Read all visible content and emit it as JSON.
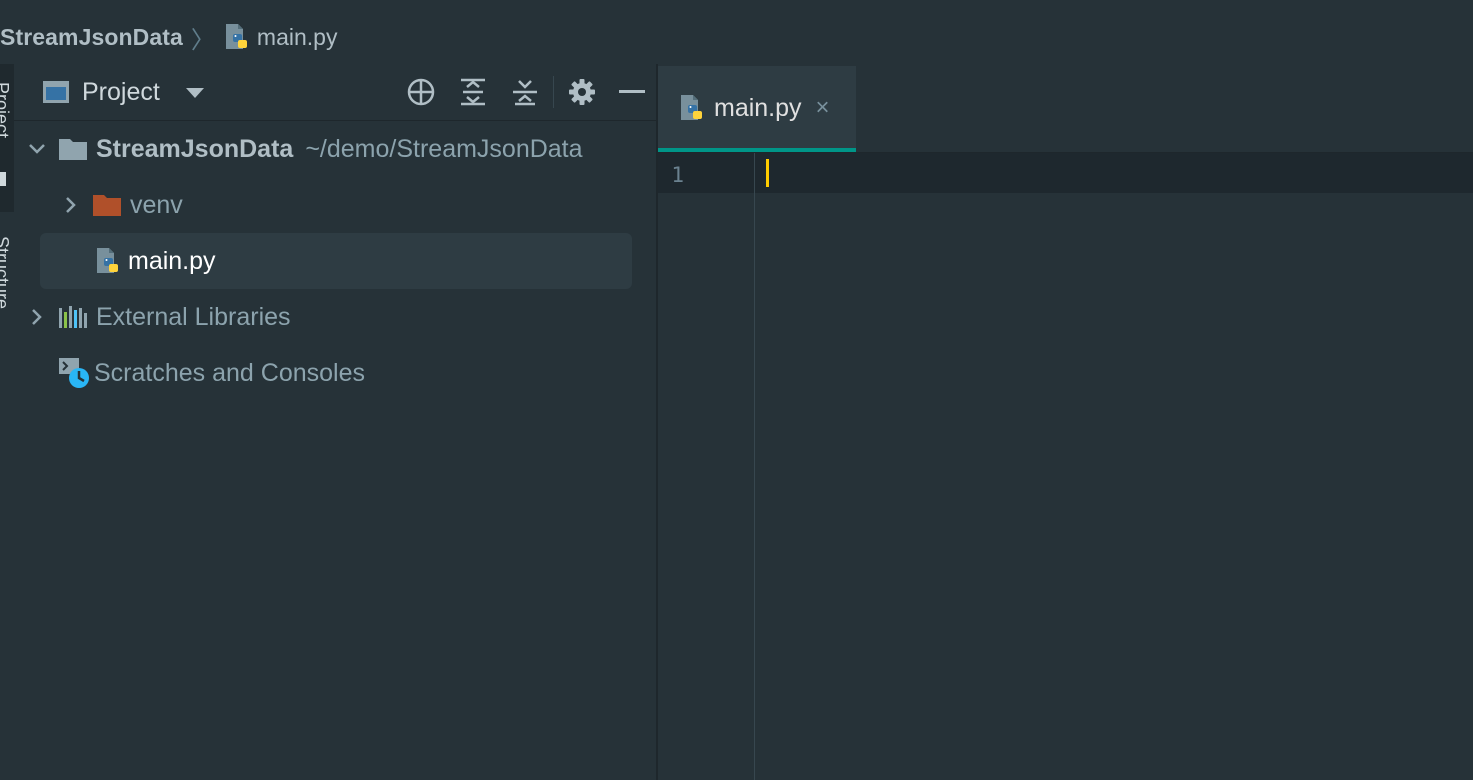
{
  "breadcrumb": {
    "project": "StreamJsonData",
    "separator": "〉",
    "file": "main.py"
  },
  "tool_stripe": {
    "project_label": "Project",
    "structure_label": "Structure"
  },
  "project_panel": {
    "title": "Project",
    "tools": [
      "locate-icon",
      "expand-all-icon",
      "collapse-all-icon",
      "gear-icon",
      "hide-icon"
    ],
    "tree": {
      "root": {
        "name": "StreamJsonData",
        "path": "~/demo/StreamJsonData",
        "expanded": true
      },
      "venv": {
        "name": "venv",
        "expanded": false
      },
      "main": {
        "name": "main.py",
        "selected": true
      },
      "external": {
        "name": "External Libraries",
        "expanded": false
      },
      "scratches": {
        "name": "Scratches and Consoles"
      }
    }
  },
  "editor": {
    "tab_label": "main.py",
    "tab_close": "×",
    "line_numbers": [
      "1"
    ]
  },
  "colors": {
    "background": "#263238",
    "accent": "#009688",
    "caret": "#ffcc00",
    "folder_venv": "#b0502a",
    "selection": "#2e3c43"
  }
}
